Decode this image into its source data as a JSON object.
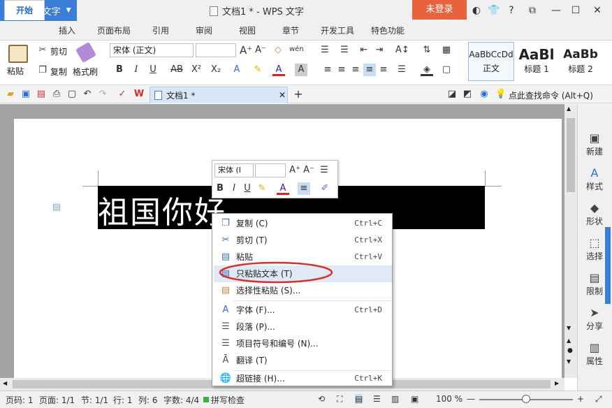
{
  "app": {
    "logo": "W",
    "name": "WPS 文字"
  },
  "window": {
    "title": "文档1 * - WPS 文字",
    "login": "未登录"
  },
  "menu_tabs": [
    "开始",
    "插入",
    "页面布局",
    "引用",
    "审阅",
    "视图",
    "章节",
    "开发工具",
    "特色功能"
  ],
  "ribbon": {
    "paste": "粘贴",
    "cut": "剪切",
    "copy": "复制",
    "format_painter": "格式刷",
    "font_name": "宋体 (正文)",
    "font_size": "",
    "styles": [
      {
        "preview": "AaBbCcDd",
        "name": "正文"
      },
      {
        "preview": "AaBl",
        "name": "标题 1"
      },
      {
        "preview": "AaBb",
        "name": "标题 2"
      }
    ]
  },
  "quickbar": {
    "doc_tab": "文档1 *",
    "search_hint": "点此查找命令 (Alt+Q)"
  },
  "document": {
    "text": "祖国你好"
  },
  "mini_toolbar": {
    "font_name": "宋体 (I",
    "font_size": ""
  },
  "context_menu": [
    {
      "label": "复制 (C)",
      "shortcut": "Ctrl+C",
      "icon": "copy-icon"
    },
    {
      "label": "剪切 (T)",
      "shortcut": "Ctrl+X",
      "icon": "scissors-icon"
    },
    {
      "label": "粘贴",
      "shortcut": "Ctrl+V",
      "icon": "paste-icon"
    },
    {
      "label": "只粘贴文本 (T)",
      "shortcut": "",
      "icon": "paste-text-icon"
    },
    {
      "label": "选择性粘贴 (S)...",
      "shortcut": "",
      "icon": "paste-special-icon"
    },
    {
      "label": "字体 (F)...",
      "shortcut": "Ctrl+D",
      "icon": "font-icon"
    },
    {
      "label": "段落 (P)...",
      "shortcut": "",
      "icon": "paragraph-icon"
    },
    {
      "label": "项目符号和编号 (N)...",
      "shortcut": "",
      "icon": "bullets-icon"
    },
    {
      "label": "翻译 (T)",
      "shortcut": "",
      "icon": "translate-icon"
    },
    {
      "label": "超链接 (H)...",
      "shortcut": "Ctrl+K",
      "icon": "hyperlink-icon"
    }
  ],
  "right_panel": [
    "新建",
    "样式",
    "形状",
    "选择",
    "限制",
    "分享",
    "属性"
  ],
  "status": {
    "page": "页码: 1",
    "pages": "页面: 1/1",
    "section": "节: 1/1",
    "row": "行: 1",
    "col": "列: 6",
    "words": "字数: 4/4",
    "spell": "拼写检查",
    "zoom": "100 %"
  },
  "colors": {
    "accent": "#3a7fd5",
    "login": "#e8623d",
    "highlight_circle": "#d9302b"
  }
}
